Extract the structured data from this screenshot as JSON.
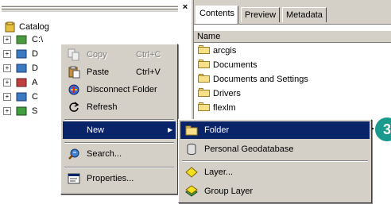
{
  "catalog": {
    "root_label": "Catalog",
    "items": [
      {
        "label": "C:\\"
      },
      {
        "label": "D"
      },
      {
        "label": "D"
      },
      {
        "label": "A"
      },
      {
        "label": "C"
      },
      {
        "label": "S"
      }
    ]
  },
  "contents_pane": {
    "tabs": [
      "Contents",
      "Preview",
      "Metadata"
    ],
    "column_header": "Name",
    "rows": [
      "arcgis",
      "Documents",
      "Documents and Settings",
      "Drivers",
      "flexlm"
    ]
  },
  "context_menu": {
    "copy": {
      "label": "Copy",
      "shortcut": "Ctrl+C",
      "disabled": true
    },
    "paste": {
      "label": "Paste",
      "shortcut": "Ctrl+V"
    },
    "disconnect": {
      "label": "Disconnect Folder"
    },
    "refresh": {
      "label": "Refresh"
    },
    "new": {
      "label": "New",
      "arrow": "▶"
    },
    "search": {
      "label": "Search..."
    },
    "properties": {
      "label": "Properties..."
    }
  },
  "new_submenu": {
    "folder": {
      "label": "Folder"
    },
    "personal_gdb": {
      "label": "Personal Geodatabase"
    },
    "layer": {
      "label": "Layer..."
    },
    "group_layer": {
      "label": "Group Layer"
    }
  },
  "callout": {
    "number": "3",
    "color": "#1a9a8c"
  },
  "colors": {
    "highlight": "#0a246a",
    "menu_bg": "#d4d0c8",
    "folder": "#f7e08a"
  }
}
